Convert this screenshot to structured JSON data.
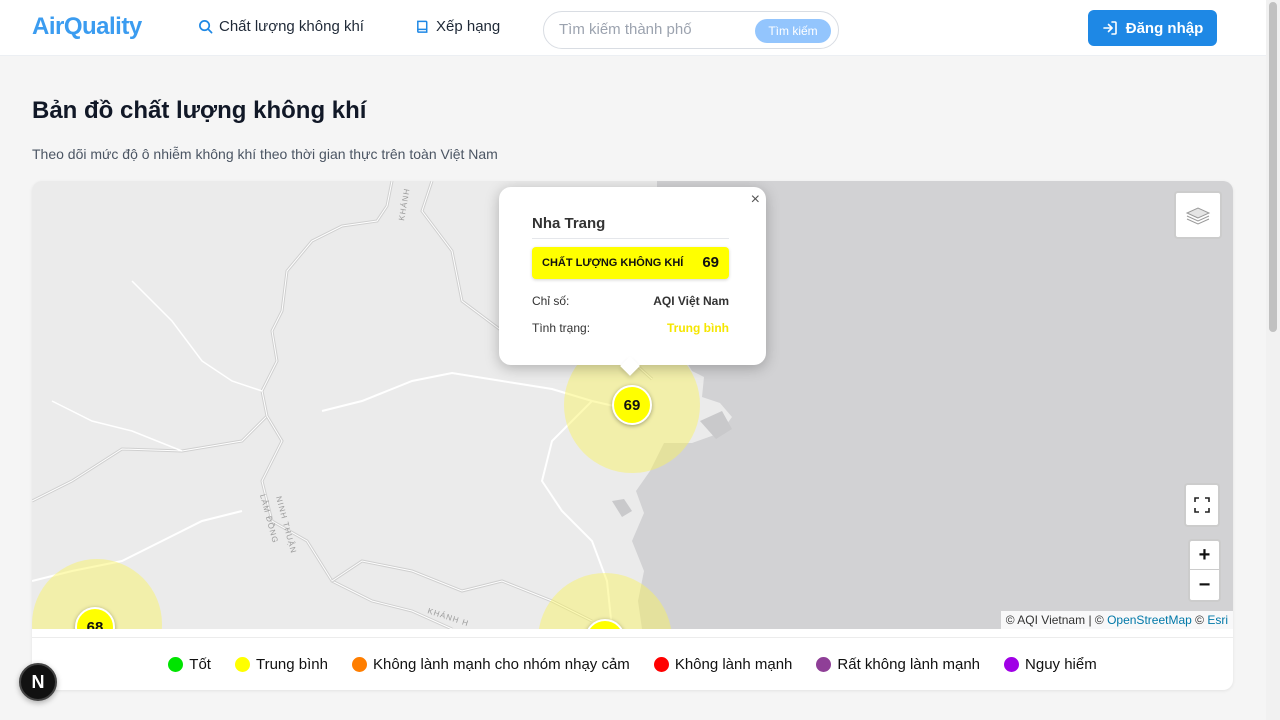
{
  "header": {
    "brand": "AirQuality",
    "nav": {
      "aqi_label": "Chất lượng không khí",
      "ranking_label": "Xếp hạng"
    },
    "search": {
      "placeholder": "Tìm kiếm thành phố",
      "button_label": "Tìm kiếm"
    },
    "login_label": "Đăng nhập"
  },
  "page": {
    "title": "Bản đồ chất lượng không khí",
    "subtitle": "Theo dõi mức độ ô nhiễm không khí theo thời gian thực trên toàn Việt Nam"
  },
  "map": {
    "labels": {
      "khanh_hoa_top": "KHÁNH",
      "lam_dong": "LÂM ĐỒNG",
      "ninh_thuan": "NINH THUẬN",
      "khanh_hoa_bottom": "KHÁNH H"
    },
    "markers": [
      {
        "value": "69"
      },
      {
        "value": "68"
      },
      {
        "value": ""
      }
    ],
    "popup": {
      "city": "Nha Trang",
      "aqi_label": "CHẤT LƯỢNG KHÔNG KHÍ",
      "aqi_value": "69",
      "index_key": "Chỉ số:",
      "index_value": "AQI Việt Nam",
      "status_key": "Tình trạng:",
      "status_value": "Trung bình",
      "close": "×"
    },
    "zoom_in": "+",
    "zoom_out": "−",
    "attribution": {
      "aqi": "© AQI Vietnam | ©",
      "osm": "OpenStreetMap",
      "sep": "©",
      "esri": "Esri"
    }
  },
  "legend": [
    {
      "label": "Tốt",
      "color": "#00e400"
    },
    {
      "label": "Trung bình",
      "color": "#ffff00"
    },
    {
      "label": "Không lành mạnh cho nhóm nhạy cảm",
      "color": "#ff7e00"
    },
    {
      "label": "Không lành mạnh",
      "color": "#ff0000"
    },
    {
      "label": "Rất không lành mạnh",
      "color": "#8f3f97"
    },
    {
      "label": "Nguy hiểm",
      "color": "#a000e6"
    }
  ],
  "colors": {
    "brand": "#3b9cf0",
    "primary": "#1e88e5",
    "moderate": "#ffff00"
  },
  "icons": [
    "search-icon",
    "book-icon",
    "login-icon",
    "layers-icon",
    "fullscreen-icon",
    "close-icon",
    "nextjs-icon"
  ],
  "dev_badge": "N"
}
